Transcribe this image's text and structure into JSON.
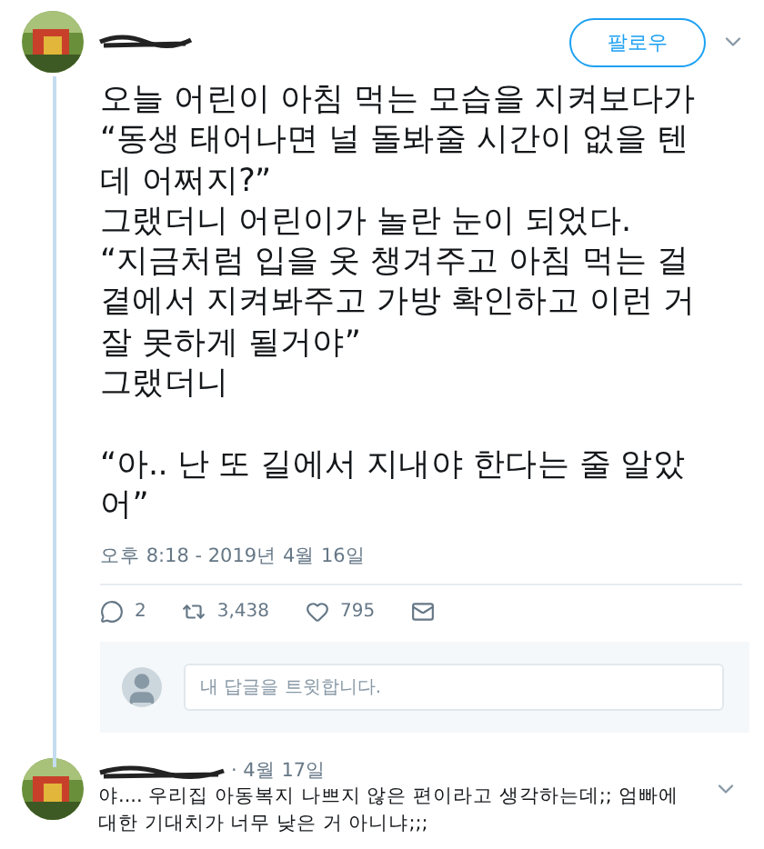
{
  "tweet": {
    "follow_button": "팔로우",
    "text": "오늘 어린이 아침 먹는 모습을 지켜보다가\n“동생 태어나면 널 돌봐줄 시간이 없을 텐\n데 어쩌지?”\n그랬더니 어린이가 놀란 눈이 되었다.\n“지금처럼 입을 옷 챙겨주고 아침 먹는 걸\n곁에서 지켜봐주고 가방 확인하고 이런 거\n잘 못하게 될거야”\n그랬더니\n\n“아.. 난 또 길에서 지내야 한다는 줄 알았\n어”",
    "timestamp": "오후 8:18 - 2019년 4월 16일",
    "actions": [
      {
        "kind": "reply",
        "count": "2"
      },
      {
        "kind": "retweet",
        "count": "3,438"
      },
      {
        "kind": "like",
        "count": "795"
      },
      {
        "kind": "message"
      }
    ]
  },
  "reply_box": {
    "placeholder": "내 답글을 트윗합니다."
  },
  "reply": {
    "date": "· 4월 17일",
    "text": "야.... 우리집 아동복지 나쁘지 않은 편이라고 생각하는데;; 엄빠에 대한 기대치가 너무 낮은 거 아니냐;;;"
  }
}
